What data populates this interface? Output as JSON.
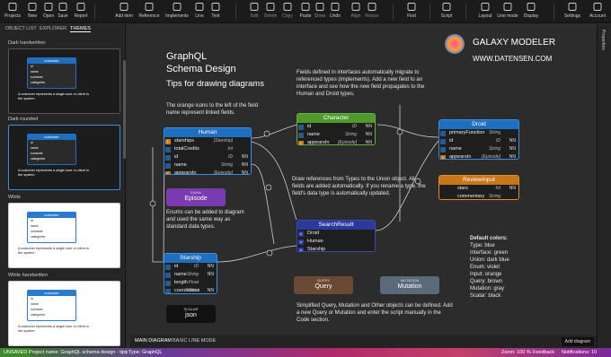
{
  "toolbar": {
    "items": [
      {
        "label": "Projects",
        "icon": "projects-icon"
      },
      {
        "label": "New",
        "icon": "new-icon"
      },
      {
        "label": "Open",
        "icon": "open-icon"
      },
      {
        "label": "Save",
        "icon": "save-icon"
      },
      {
        "label": "Report",
        "icon": "report-icon"
      },
      {
        "label": "Add item",
        "icon": "add-item-icon"
      },
      {
        "label": "Reference",
        "icon": "reference-icon"
      },
      {
        "label": "Implements",
        "icon": "implements-icon"
      },
      {
        "label": "Line",
        "icon": "line-icon"
      },
      {
        "label": "Text",
        "icon": "text-icon"
      },
      {
        "label": "Edit",
        "icon": "edit-icon"
      },
      {
        "label": "Delete",
        "icon": "delete-icon"
      },
      {
        "label": "Copy",
        "icon": "copy-icon"
      },
      {
        "label": "Paste",
        "icon": "paste-icon"
      },
      {
        "label": "Show",
        "icon": "show-icon"
      },
      {
        "label": "Undo",
        "icon": "undo-icon"
      },
      {
        "label": "Align",
        "icon": "align-icon"
      },
      {
        "label": "Resize",
        "icon": "resize-icon"
      },
      {
        "label": "Find",
        "icon": "find-icon"
      },
      {
        "label": "Script",
        "icon": "script-icon"
      },
      {
        "label": "Layout",
        "icon": "layout-icon"
      },
      {
        "label": "Line mode",
        "icon": "line-mode-icon"
      },
      {
        "label": "Display",
        "icon": "display-icon"
      },
      {
        "label": "Settings",
        "icon": "settings-icon"
      },
      {
        "label": "Account",
        "icon": "account-icon"
      }
    ]
  },
  "left_panel": {
    "tabs": [
      "OBJECT LIST",
      "EXPLORER",
      "THEMES"
    ],
    "themes": [
      {
        "title": "Dark handwritten",
        "card": "customer",
        "rows": [
          "id",
          "name",
          "surname",
          "categories"
        ],
        "desc": "A customer represents a single user or client in the system."
      },
      {
        "title": "Dark rounded",
        "card": "customer",
        "rows": [
          "id",
          "name",
          "surname",
          "categories"
        ],
        "desc": "A customer represents a single user or client in the system."
      },
      {
        "title": "White",
        "card": "customer",
        "rows": [
          "id",
          "name",
          "surname",
          "categories"
        ],
        "desc": "A customer represents a single user or client in the system."
      },
      {
        "title": "White handwritten",
        "card": "customer",
        "rows": [
          "id",
          "name",
          "surname",
          "categories"
        ],
        "desc": "A customer represents a single user or client in the system."
      }
    ]
  },
  "right_panel": {
    "tab": "Properties"
  },
  "canvas": {
    "title": [
      "GraphQL",
      "Schema Design",
      "Tips for drawing diagrams"
    ],
    "brand": {
      "name": "GALAXY MODELER",
      "url": "WWW.DATENSEN.COM"
    },
    "notes": {
      "orange": "The orange icons to the left of the field name represent linked fields.",
      "interfaces": "Fields defined in interfaces automatically migrate to referenced types (implements). Add a new field to an interface and see how the new field propagates to the Human and Droid types.",
      "enums": "Enums can be added to diagram and used the same way as standard data types.",
      "union": "Draw references from Types to the Union object. All fields are added automatically. If you rename a type, the field's data type is automatically updated.",
      "query": "Simplified Query, Mutation and Other objects can be defined. Add a new Query or Mutation and enter the script manually in the Code section."
    },
    "default_colors": {
      "title": "Default colors:",
      "items": [
        "Type: blue",
        "Interface: green",
        "Union: dark blue",
        "Enum: violet",
        "Input: orange",
        "Query: brown",
        "Mutation: gray",
        "Scalar: black"
      ]
    },
    "human": {
      "name": "Human",
      "rows": [
        {
          "k": "L",
          "n": "starships",
          "t": "[Starship]",
          "nn": ""
        },
        {
          "k": "",
          "n": "totalCredits",
          "t": "Int",
          "nn": ""
        },
        {
          "k": "",
          "n": "id",
          "t": "ID",
          "nn": "NN"
        },
        {
          "k": "",
          "n": "name",
          "t": "String",
          "nn": "NN"
        },
        {
          "k": "L",
          "n": "appearsIn",
          "t": "[Episode]",
          "nn": "NN"
        }
      ]
    },
    "character": {
      "name": "Character",
      "rows": [
        {
          "k": "",
          "n": "id",
          "t": "ID",
          "nn": "NN"
        },
        {
          "k": "",
          "n": "name",
          "t": "String",
          "nn": "NN"
        },
        {
          "k": "L",
          "n": "appearsIn",
          "t": "[Episode]",
          "nn": "NN"
        }
      ]
    },
    "droid": {
      "name": "Droid",
      "rows": [
        {
          "k": "",
          "n": "primaryFunction",
          "t": "String",
          "nn": ""
        },
        {
          "k": "",
          "n": "id",
          "t": "ID",
          "nn": "NN"
        },
        {
          "k": "",
          "n": "name",
          "t": "String",
          "nn": "NN"
        },
        {
          "k": "L",
          "n": "appearsIn",
          "t": "[Episode]",
          "nn": "NN"
        }
      ]
    },
    "review": {
      "name": "ReviewInput",
      "rows": [
        {
          "n": "stars",
          "t": "Int",
          "nn": "NN"
        },
        {
          "n": "commentary",
          "t": "String",
          "nn": ""
        }
      ]
    },
    "search": {
      "name": "SearchResult",
      "rows": [
        "Droid",
        "Human",
        "Starship"
      ]
    },
    "starship": {
      "name": "Starship",
      "rows": [
        {
          "n": "id",
          "t": "ID",
          "nn": "NN"
        },
        {
          "n": "name",
          "t": "String",
          "nn": "NN"
        },
        {
          "n": "length",
          "t": "Float",
          "nn": ""
        },
        {
          "n": "coordinates",
          "t": "Float",
          "nn": "NN"
        }
      ]
    },
    "episode": {
      "label": "ENUM",
      "name": "Episode"
    },
    "json": {
      "label": "SCALAR",
      "name": "json"
    },
    "query": {
      "label": "QUERY",
      "name": "Query"
    },
    "mutation": {
      "label": "MUTATION",
      "name": "Mutation"
    }
  },
  "bottom_tabs": [
    "MAIN DIAGRAM",
    "BASIC LINE MODE"
  ],
  "add_diagram": "Add diagram",
  "status": {
    "unsaved": "UNSAVED",
    "project": "Project name: GraphQL schema design - tips",
    "type": "| Type: GraphQL",
    "zoom": "Zoom: 100 %",
    "feedback": "Feedback",
    "notifications": "Notifications: 10"
  }
}
